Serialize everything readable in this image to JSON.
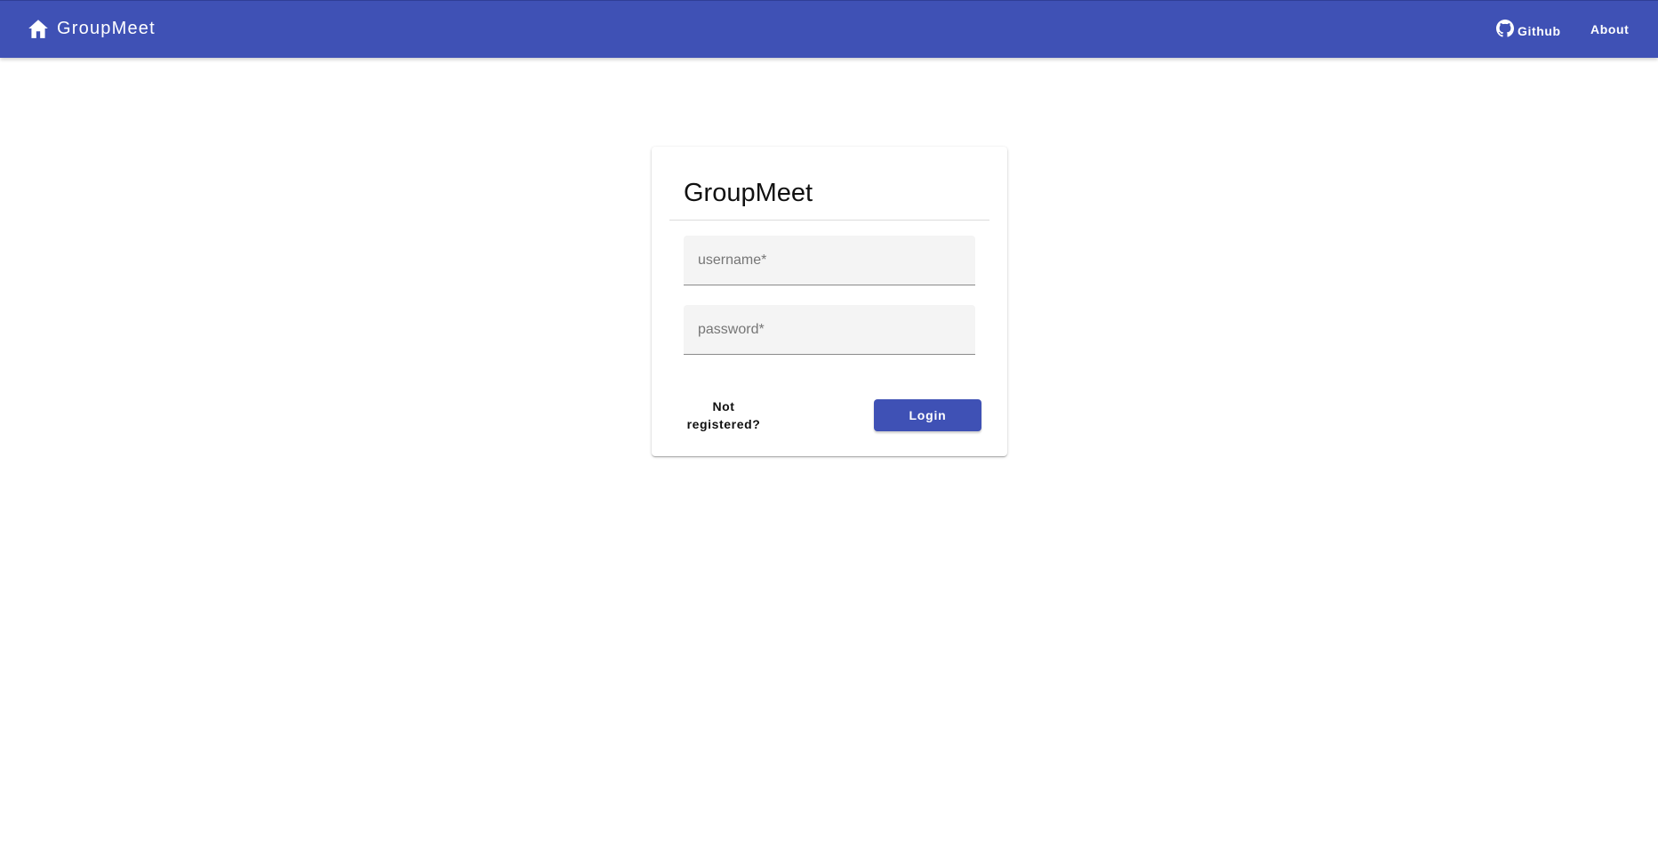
{
  "appbar": {
    "brand_label": "GroupMeet",
    "brand_icon": "home-icon",
    "nav": {
      "github_label": "Github",
      "github_icon": "github-icon",
      "about_label": "About"
    },
    "color": "#3f51b5"
  },
  "login_card": {
    "title": "GroupMeet",
    "username": {
      "value": "",
      "placeholder": "username*"
    },
    "password": {
      "value": "",
      "placeholder": "password*"
    },
    "register_label": "Not registered?",
    "login_label": "Login"
  }
}
